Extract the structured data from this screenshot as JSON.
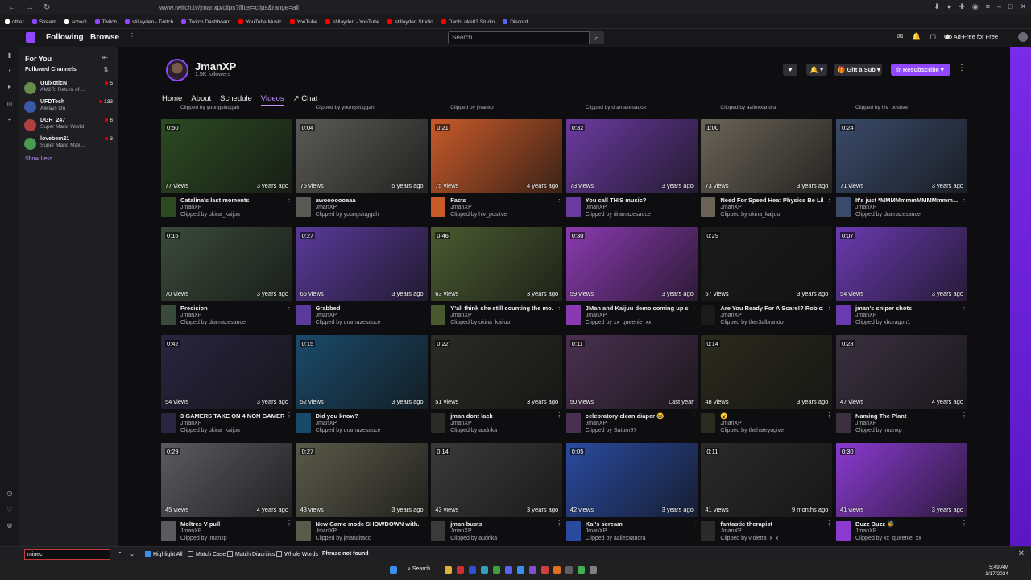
{
  "browser": {
    "url": "www.twitch.tv/jmanxp/clips?filter=clips&range=all",
    "bookmarks": [
      {
        "label": "other",
        "color": "#ffffff"
      },
      {
        "label": "Stream",
        "color": "#9147ff"
      },
      {
        "label": "school",
        "color": "#ffffff"
      },
      {
        "label": "Twitch",
        "color": "#9147ff"
      },
      {
        "label": "stillayden - Twitch",
        "color": "#9147ff"
      },
      {
        "label": "Twitch Dashboard",
        "color": "#9147ff"
      },
      {
        "label": "YouTube Music",
        "color": "#ff0000"
      },
      {
        "label": "YouTube",
        "color": "#ff0000"
      },
      {
        "label": "stillayden - YouTube",
        "color": "#ff0000"
      },
      {
        "label": "stillayden Studio",
        "color": "#ff0000"
      },
      {
        "label": "DarthLuke83 Studio",
        "color": "#ff0000"
      },
      {
        "label": "Discord",
        "color": "#5865f2"
      }
    ]
  },
  "topnav": {
    "following": "Following",
    "browse": "Browse",
    "search_placeholder": "Search",
    "notif_count": "1",
    "ad_free": "Go Ad-Free for Free"
  },
  "sidebar": {
    "for_you": "For You",
    "followed_channels": "Followed Channels",
    "show_less": "Show Less",
    "channels": [
      {
        "name": "QuixoticN",
        "game": "AM2R: Return of ...",
        "viewers": "5",
        "color": "#6a8a4a"
      },
      {
        "name": "UFDTech",
        "game": "Always On",
        "viewers": "133",
        "color": "#3a5aa8"
      },
      {
        "name": "DGR_247",
        "game": "Super Mario World",
        "viewers": "6",
        "color": "#b04040"
      },
      {
        "name": "lovebem21",
        "game": "Super Mario Mak...",
        "viewers": "3",
        "color": "#4a9a50"
      }
    ]
  },
  "channel": {
    "name": "JmanXP",
    "followers": "1.5K followers",
    "gift_label": "Gift a Sub",
    "resub_label": "Resubscribe",
    "tabs": [
      "Home",
      "About",
      "Schedule",
      "Videos",
      "Chat"
    ],
    "active_tab": "Videos"
  },
  "prev_row_clippers": [
    "Clipped by youngsluggah",
    "Clipped by youngsluggah",
    "Clipped by jmanxp",
    "Clipped by dramazesauce",
    "Clipped by aallexxandra",
    "Clipped by hiv_positve"
  ],
  "clips": [
    {
      "dur": "0:50",
      "views": "77 views",
      "age": "3 years ago",
      "title": "Catalina's last moments",
      "channel": "JmanXP",
      "clipper": "Clipped by okina_kaijuu",
      "bg": "#2c4a22"
    },
    {
      "dur": "0:04",
      "views": "75 views",
      "age": "5 years ago",
      "title": "awooooooaaa",
      "channel": "JmanXP",
      "clipper": "Clipped by youngsluggah",
      "bg": "#5a5a55"
    },
    {
      "dur": "0:21",
      "views": "75 views",
      "age": "4 years ago",
      "title": "Facts",
      "channel": "JmanXP",
      "clipper": "Clipped by hiv_positve",
      "bg": "#c85a2a"
    },
    {
      "dur": "0:32",
      "views": "73 views",
      "age": "3 years ago",
      "title": "You call THIS music?",
      "channel": "JmanXP",
      "clipper": "Clipped by dramazesauce",
      "bg": "#6a3aa0"
    },
    {
      "dur": "1:00",
      "views": "73 views",
      "age": "3 years ago",
      "title": "Need For Speed Heat Physics Be Like",
      "channel": "JmanXP",
      "clipper": "Clipped by okina_kaijuu",
      "bg": "#6a6458"
    },
    {
      "dur": "0:24",
      "views": "71 views",
      "age": "3 years ago",
      "title": "It's just *MMMMmmmMMMMmmm...",
      "channel": "JmanXP",
      "clipper": "Clipped by dramazesauce",
      "bg": "#3a4a6a"
    },
    {
      "dur": "0:16",
      "views": "70 views",
      "age": "3 years ago",
      "title": "Precision",
      "channel": "JmanXP",
      "clipper": "Clipped by dramazesauce",
      "bg": "#3a4a3a"
    },
    {
      "dur": "0:27",
      "views": "65 views",
      "age": "3 years ago",
      "title": "Grabbed",
      "channel": "JmanXP",
      "clipper": "Clipped by dramazesauce",
      "bg": "#5a3a9a"
    },
    {
      "dur": "0:46",
      "views": "63 views",
      "age": "3 years ago",
      "title": "Y'all think she still counting the mo...",
      "channel": "JmanXP",
      "clipper": "Clipped by okina_kaijuu",
      "bg": "#4a5a30"
    },
    {
      "dur": "0:30",
      "views": "59 views",
      "age": "3 years ago",
      "title": "JMan and Kaijuu demo coming up s...",
      "channel": "JmanXP",
      "clipper": "Clipped by xx_queenie_xx_",
      "bg": "#8a3ab0"
    },
    {
      "dur": "0:29",
      "views": "57 views",
      "age": "3 years ago",
      "title": "Are You Ready For A Scare!? Roblox...",
      "channel": "JmanXP",
      "clipper": "Clipped by ther3albrando",
      "bg": "#1a1a1a"
    },
    {
      "dur": "0:07",
      "views": "54 views",
      "age": "3 years ago",
      "title": "jman's sniper shots",
      "channel": "JmanXP",
      "clipper": "Clipped by xbdragon1",
      "bg": "#6a3ab0"
    },
    {
      "dur": "0:42",
      "views": "54 views",
      "age": "3 years ago",
      "title": "3 GAMERS TAKE ON 4 NON GAMER...",
      "channel": "JmanXP",
      "clipper": "Clipped by okina_kaijuu",
      "bg": "#2a2440"
    },
    {
      "dur": "0:15",
      "views": "52 views",
      "age": "3 years ago",
      "title": "Did you know?",
      "channel": "JmanXP",
      "clipper": "Clipped by dramazesauce",
      "bg": "#1a4a6a"
    },
    {
      "dur": "0:22",
      "views": "51 views",
      "age": "3 years ago",
      "title": "jman dont lack",
      "channel": "JmanXP",
      "clipper": "Clipped by audrika_",
      "bg": "#2a2a26"
    },
    {
      "dur": "0:11",
      "views": "50 views",
      "age": "Last year",
      "title": "celebratory clean diaper 😂",
      "channel": "JmanXP",
      "clipper": "Clipped by Saturn97",
      "bg": "#4a3050"
    },
    {
      "dur": "0:14",
      "views": "48 views",
      "age": "3 years ago",
      "title": "😮",
      "channel": "JmanXP",
      "clipper": "Clipped by thehateyugive",
      "bg": "#2a2a1e"
    },
    {
      "dur": "0:28",
      "views": "47 views",
      "age": "4 years ago",
      "title": "Naming The Plant",
      "channel": "JmanXP",
      "clipper": "Clipped by jmanxp",
      "bg": "#3a3040"
    },
    {
      "dur": "0:29",
      "views": "45 views",
      "age": "4 years ago",
      "title": "Moltres V pull",
      "channel": "JmanXP",
      "clipper": "Clipped by jmanxp",
      "bg": "#5a5a60"
    },
    {
      "dur": "0:27",
      "views": "43 views",
      "age": "3 years ago",
      "title": "New Game mode SHOWDOWN with...",
      "channel": "JmanXP",
      "clipper": "Clipped by jmanaltacc",
      "bg": "#5a5a4a"
    },
    {
      "dur": "0:14",
      "views": "43 views",
      "age": "3 years ago",
      "title": "jman busts",
      "channel": "JmanXP",
      "clipper": "Clipped by audrika_",
      "bg": "#3a3a3a"
    },
    {
      "dur": "0:05",
      "views": "42 views",
      "age": "3 years ago",
      "title": "Kai's scream",
      "channel": "JmanXP",
      "clipper": "Clipped by aallexxandra",
      "bg": "#2a4aa0"
    },
    {
      "dur": "0:11",
      "views": "41 views",
      "age": "9 months ago",
      "title": "fantastic therapist",
      "channel": "JmanXP",
      "clipper": "Clipped by violetta_x_x",
      "bg": "#2a2a2a"
    },
    {
      "dur": "0:30",
      "views": "41 views",
      "age": "3 years ago",
      "title": "Buzz Buzz 🐝",
      "channel": "JmanXP",
      "clipper": "Clipped by xx_queenie_xx_",
      "bg": "#8a3ad0"
    }
  ],
  "findbar": {
    "query": "minec",
    "highlight_all": "Highlight All",
    "match_case": "Match Case",
    "match_diacritics": "Match Diacritics",
    "whole_words": "Whole Words",
    "status": "Phrase not found"
  },
  "taskbar": {
    "search": "Search",
    "time": "5:49 AM",
    "date": "1/17/2024"
  }
}
